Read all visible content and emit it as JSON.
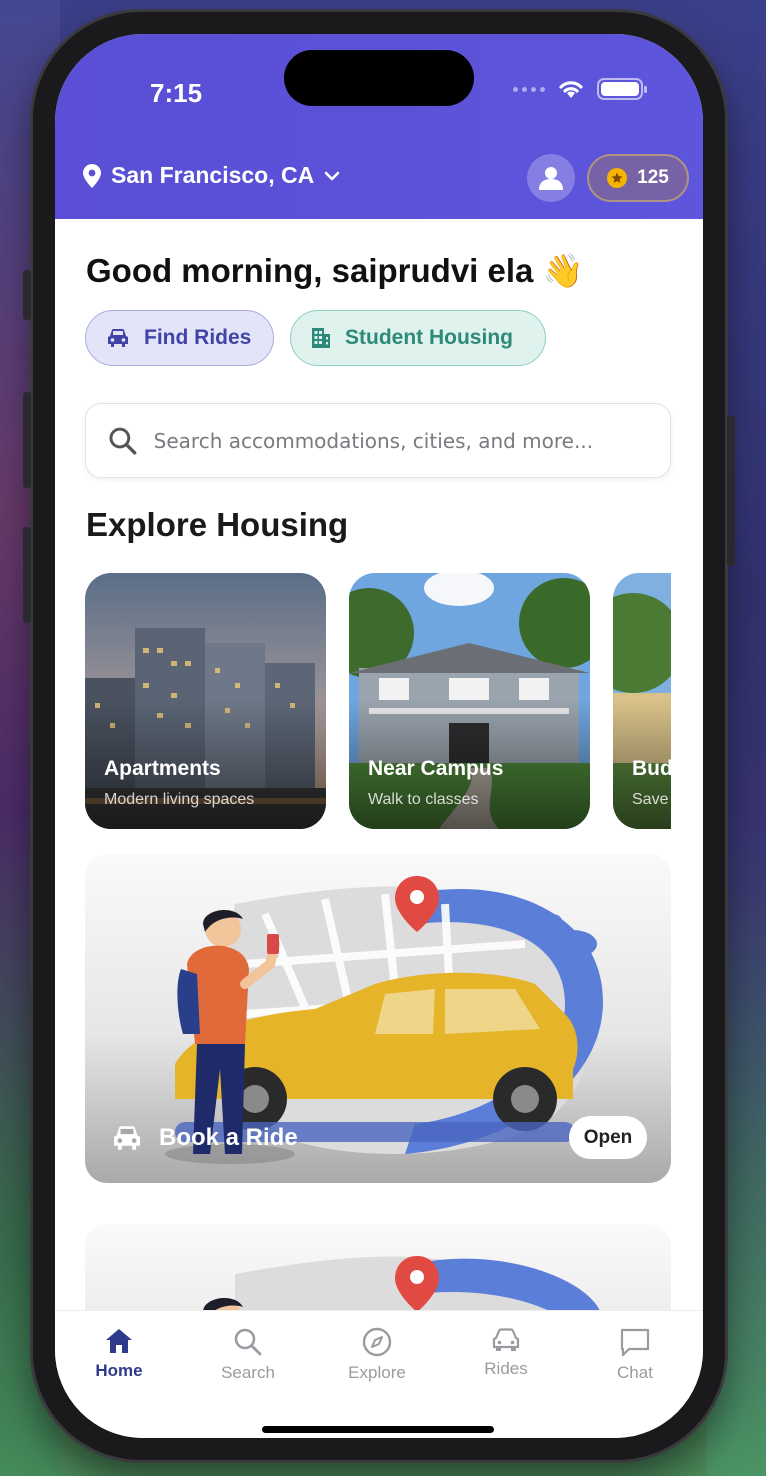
{
  "status_bar": {
    "time": "7:15"
  },
  "header": {
    "location": "San Francisco, CA",
    "points": "125",
    "accent_color": "#5a4fd6"
  },
  "greeting": "Good morning, saiprudvi ela 👋",
  "chips": [
    {
      "label": "Find Rides",
      "icon": "car-icon"
    },
    {
      "label": "Student Housing",
      "icon": "building-icon"
    }
  ],
  "search": {
    "placeholder": "Search accommodations, cities, and more..."
  },
  "explore": {
    "title": "Explore Housing",
    "cards": [
      {
        "title": "Apartments",
        "subtitle": "Modern living spaces"
      },
      {
        "title": "Near Campus",
        "subtitle": "Walk to classes"
      },
      {
        "title": "Bud",
        "subtitle": "Save"
      }
    ]
  },
  "promo": {
    "label": "Book a Ride",
    "button": "Open"
  },
  "tabs": [
    {
      "label": "Home",
      "icon": "home-icon",
      "active": true
    },
    {
      "label": "Search",
      "icon": "search-icon"
    },
    {
      "label": "Explore",
      "icon": "compass-icon"
    },
    {
      "label": "Rides",
      "icon": "car-icon"
    },
    {
      "label": "Chat",
      "icon": "chat-icon"
    }
  ]
}
